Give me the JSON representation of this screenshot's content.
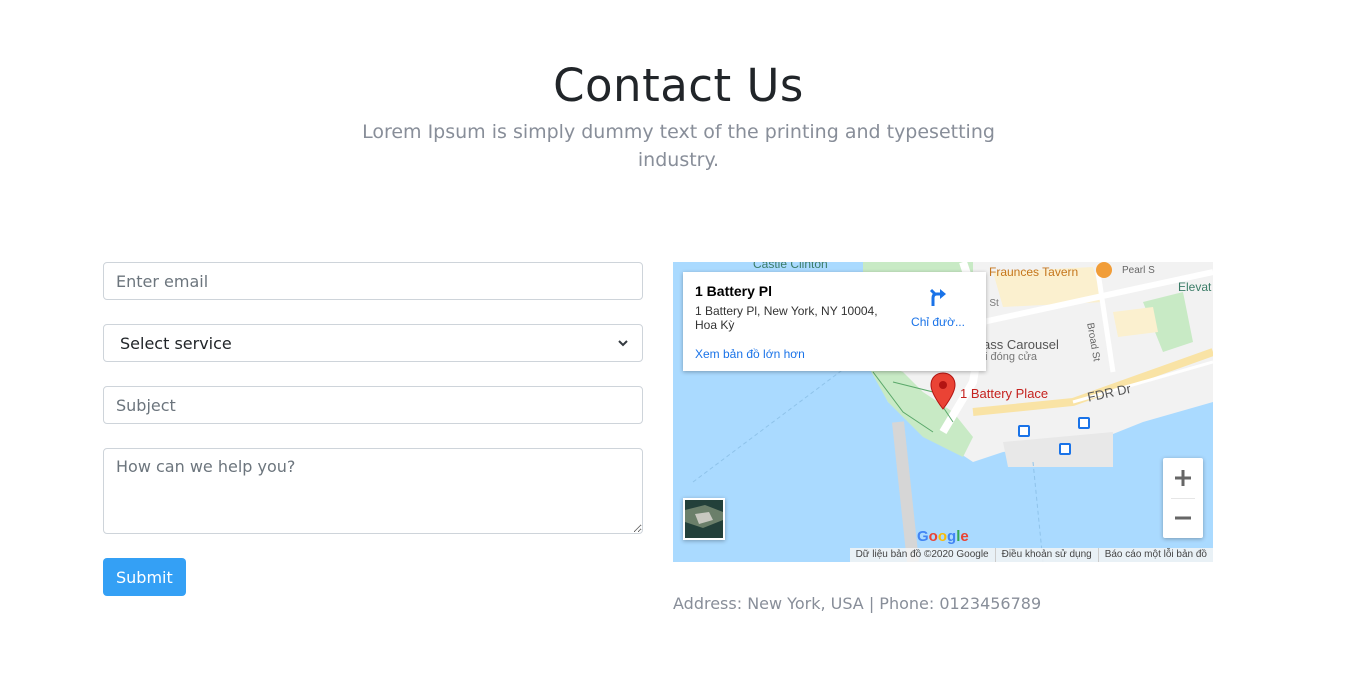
{
  "header": {
    "title": "Contact Us",
    "subtitle": "Lorem Ipsum is simply dummy text of the printing and typesetting industry."
  },
  "form": {
    "email_placeholder": "Enter email",
    "service_selected": "Select service",
    "subject_placeholder": "Subject",
    "message_placeholder": "How can we help you?",
    "submit_label": "Submit"
  },
  "map": {
    "info": {
      "title": "1 Battery Pl",
      "address": "1 Battery Pl, New York, NY 10004, Hoa Kỳ",
      "directions_label": "Chỉ đườ...",
      "larger_map_link": "Xem bản đồ lớn hơn"
    },
    "labels": {
      "castle_clinton": "Castle Clinton",
      "fraunces_tavern": "Fraunces Tavern",
      "pearl": "Pearl S",
      "eleva": "Elevat",
      "carousel": "ass Carousel",
      "carousel_sub": "i đóng cửa",
      "battery_place": "1 Battery Place",
      "fdr": "FDR Dr",
      "broad": "Broad St",
      "st1": "St",
      "st2": "rl St"
    },
    "google": "Google",
    "footer": {
      "data": "Dữ liệu bản đồ ©2020 Google",
      "terms": "Điều khoản sử dụng",
      "report": "Báo cáo một lỗi bản đồ"
    },
    "colors": {
      "water": "#aadaff",
      "park": "#c8eac5",
      "land": "#f2f2f2",
      "pin": "#ea4335",
      "link": "#1a73e8"
    }
  },
  "contact": {
    "address_line": "Address: New York, USA | Phone: 0123456789"
  },
  "colors": {
    "accent": "#34a0f5",
    "muted_text": "#888e99"
  }
}
